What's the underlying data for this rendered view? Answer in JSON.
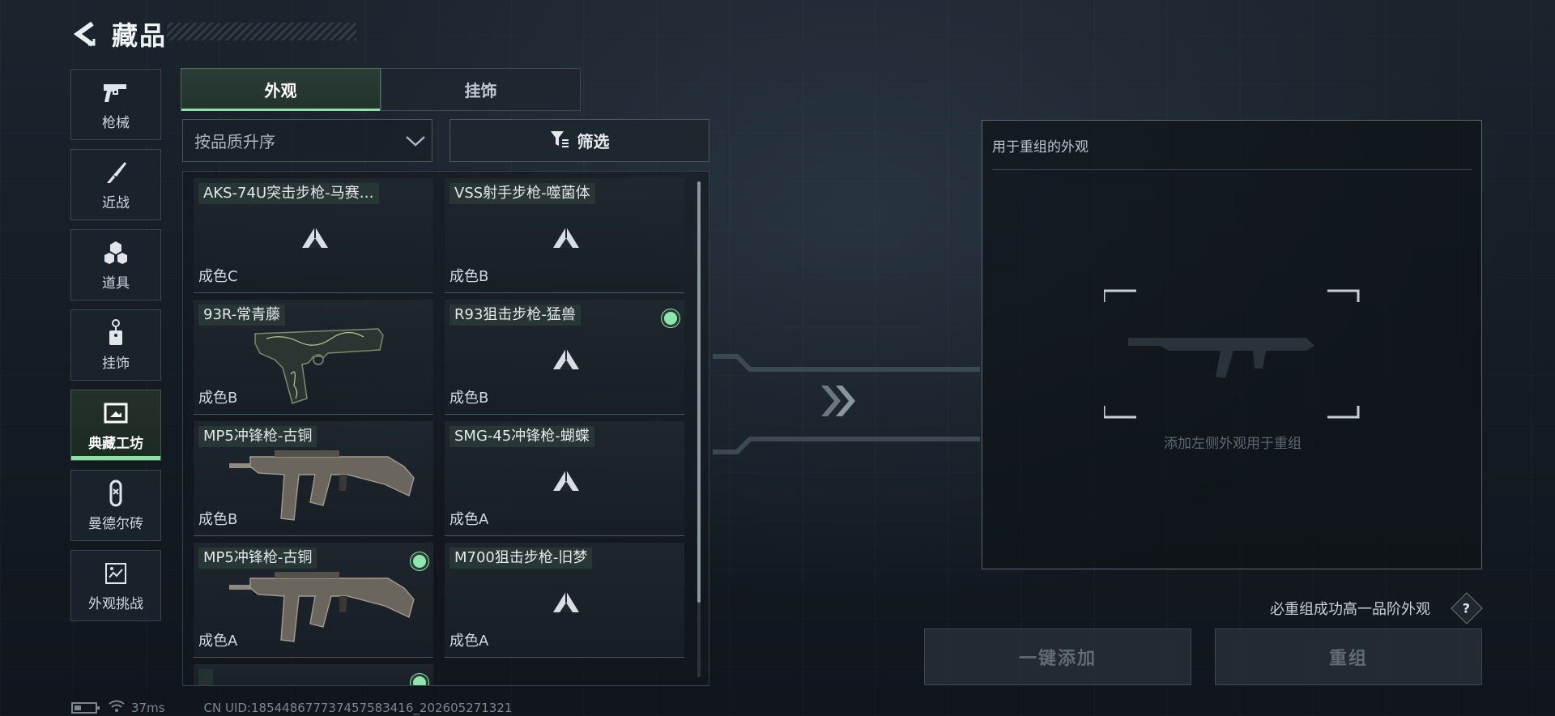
{
  "header": {
    "title": "藏品",
    "back_icon": "back-arrow-icon"
  },
  "sidebar": {
    "items": [
      {
        "label": "枪械",
        "icon": "pistol-icon",
        "active": false
      },
      {
        "label": "近战",
        "icon": "knife-icon",
        "active": false
      },
      {
        "label": "道具",
        "icon": "grenade-cluster-icon",
        "active": false
      },
      {
        "label": "挂饰",
        "icon": "charm-icon",
        "active": false
      },
      {
        "label": "典藏工坊",
        "icon": "workshop-frame-icon",
        "active": true
      },
      {
        "label": "曼德尔砖",
        "icon": "brick-icon",
        "active": false
      },
      {
        "label": "外观挑战",
        "icon": "challenge-icon",
        "active": false
      }
    ]
  },
  "tabs": [
    {
      "label": "外观",
      "active": true
    },
    {
      "label": "挂饰",
      "active": false
    }
  ],
  "sort": {
    "value": "按品质升序"
  },
  "filter": {
    "label": "筛选"
  },
  "items": [
    {
      "name": "AKS-74U突击步枪-马赛…",
      "grade": "成色C",
      "image": "placeholder-triangle",
      "selected": false
    },
    {
      "name": "VSS射手步枪-噬菌体",
      "grade": "成色B",
      "image": "placeholder-triangle",
      "selected": false
    },
    {
      "name": "93R-常青藤",
      "grade": "成色B",
      "image": "pistol-93r",
      "selected": false
    },
    {
      "name": "R93狙击步枪-猛兽",
      "grade": "成色B",
      "image": "placeholder-triangle",
      "selected": true
    },
    {
      "name": "MP5冲锋枪-古铜",
      "grade": "成色B",
      "image": "smg-mp5",
      "selected": false
    },
    {
      "name": "SMG-45冲锋枪-蝴蝶",
      "grade": "成色A",
      "image": "placeholder-triangle",
      "selected": false
    },
    {
      "name": "MP5冲锋枪-古铜",
      "grade": "成色A",
      "image": "smg-mp5",
      "selected": true
    },
    {
      "name": "M700狙击步枪-旧梦",
      "grade": "成色A",
      "image": "placeholder-triangle",
      "selected": false
    }
  ],
  "recombine_panel": {
    "title": "用于重组的外观",
    "hint": "添加左侧外观用于重组"
  },
  "upgrade_note": "必重组成功高一品阶外观",
  "help_label": "?",
  "buttons": {
    "add_all": "一键添加",
    "recombine": "重组"
  },
  "footer": {
    "ping": "37ms",
    "uid": "CN UID:18544867773745758341​6_202605271321"
  },
  "colors": {
    "accent_green": "#8ee0a8",
    "selected_dot": "#8ee6ad"
  }
}
